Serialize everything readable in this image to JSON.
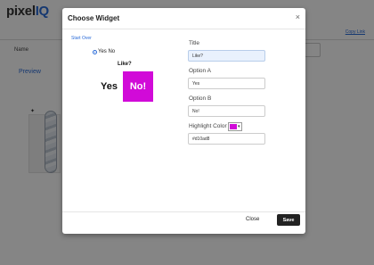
{
  "background": {
    "logo_prefix": "pixel",
    "logo_suffix": "IQ",
    "copy_link": "Copy Link",
    "name_label": "Name",
    "preview_link": "Preview"
  },
  "modal": {
    "title": "Choose Widget",
    "close_icon": "×",
    "start_over": "Start Over",
    "widget_type_option": "Yes No",
    "preview": {
      "title": "Like?",
      "option_a": "Yes",
      "option_b": "No!",
      "highlight_color": "#d10ad8"
    },
    "fields": {
      "title_label": "Title",
      "title_value": "Like?",
      "option_a_label": "Option A",
      "option_a_value": "Yes",
      "option_b_label": "Option B",
      "option_b_value": "No!",
      "highlight_label": "Highlight Color",
      "highlight_value": "#d10ad8"
    },
    "footer": {
      "close_label": "Close",
      "save_label": "Save"
    }
  }
}
